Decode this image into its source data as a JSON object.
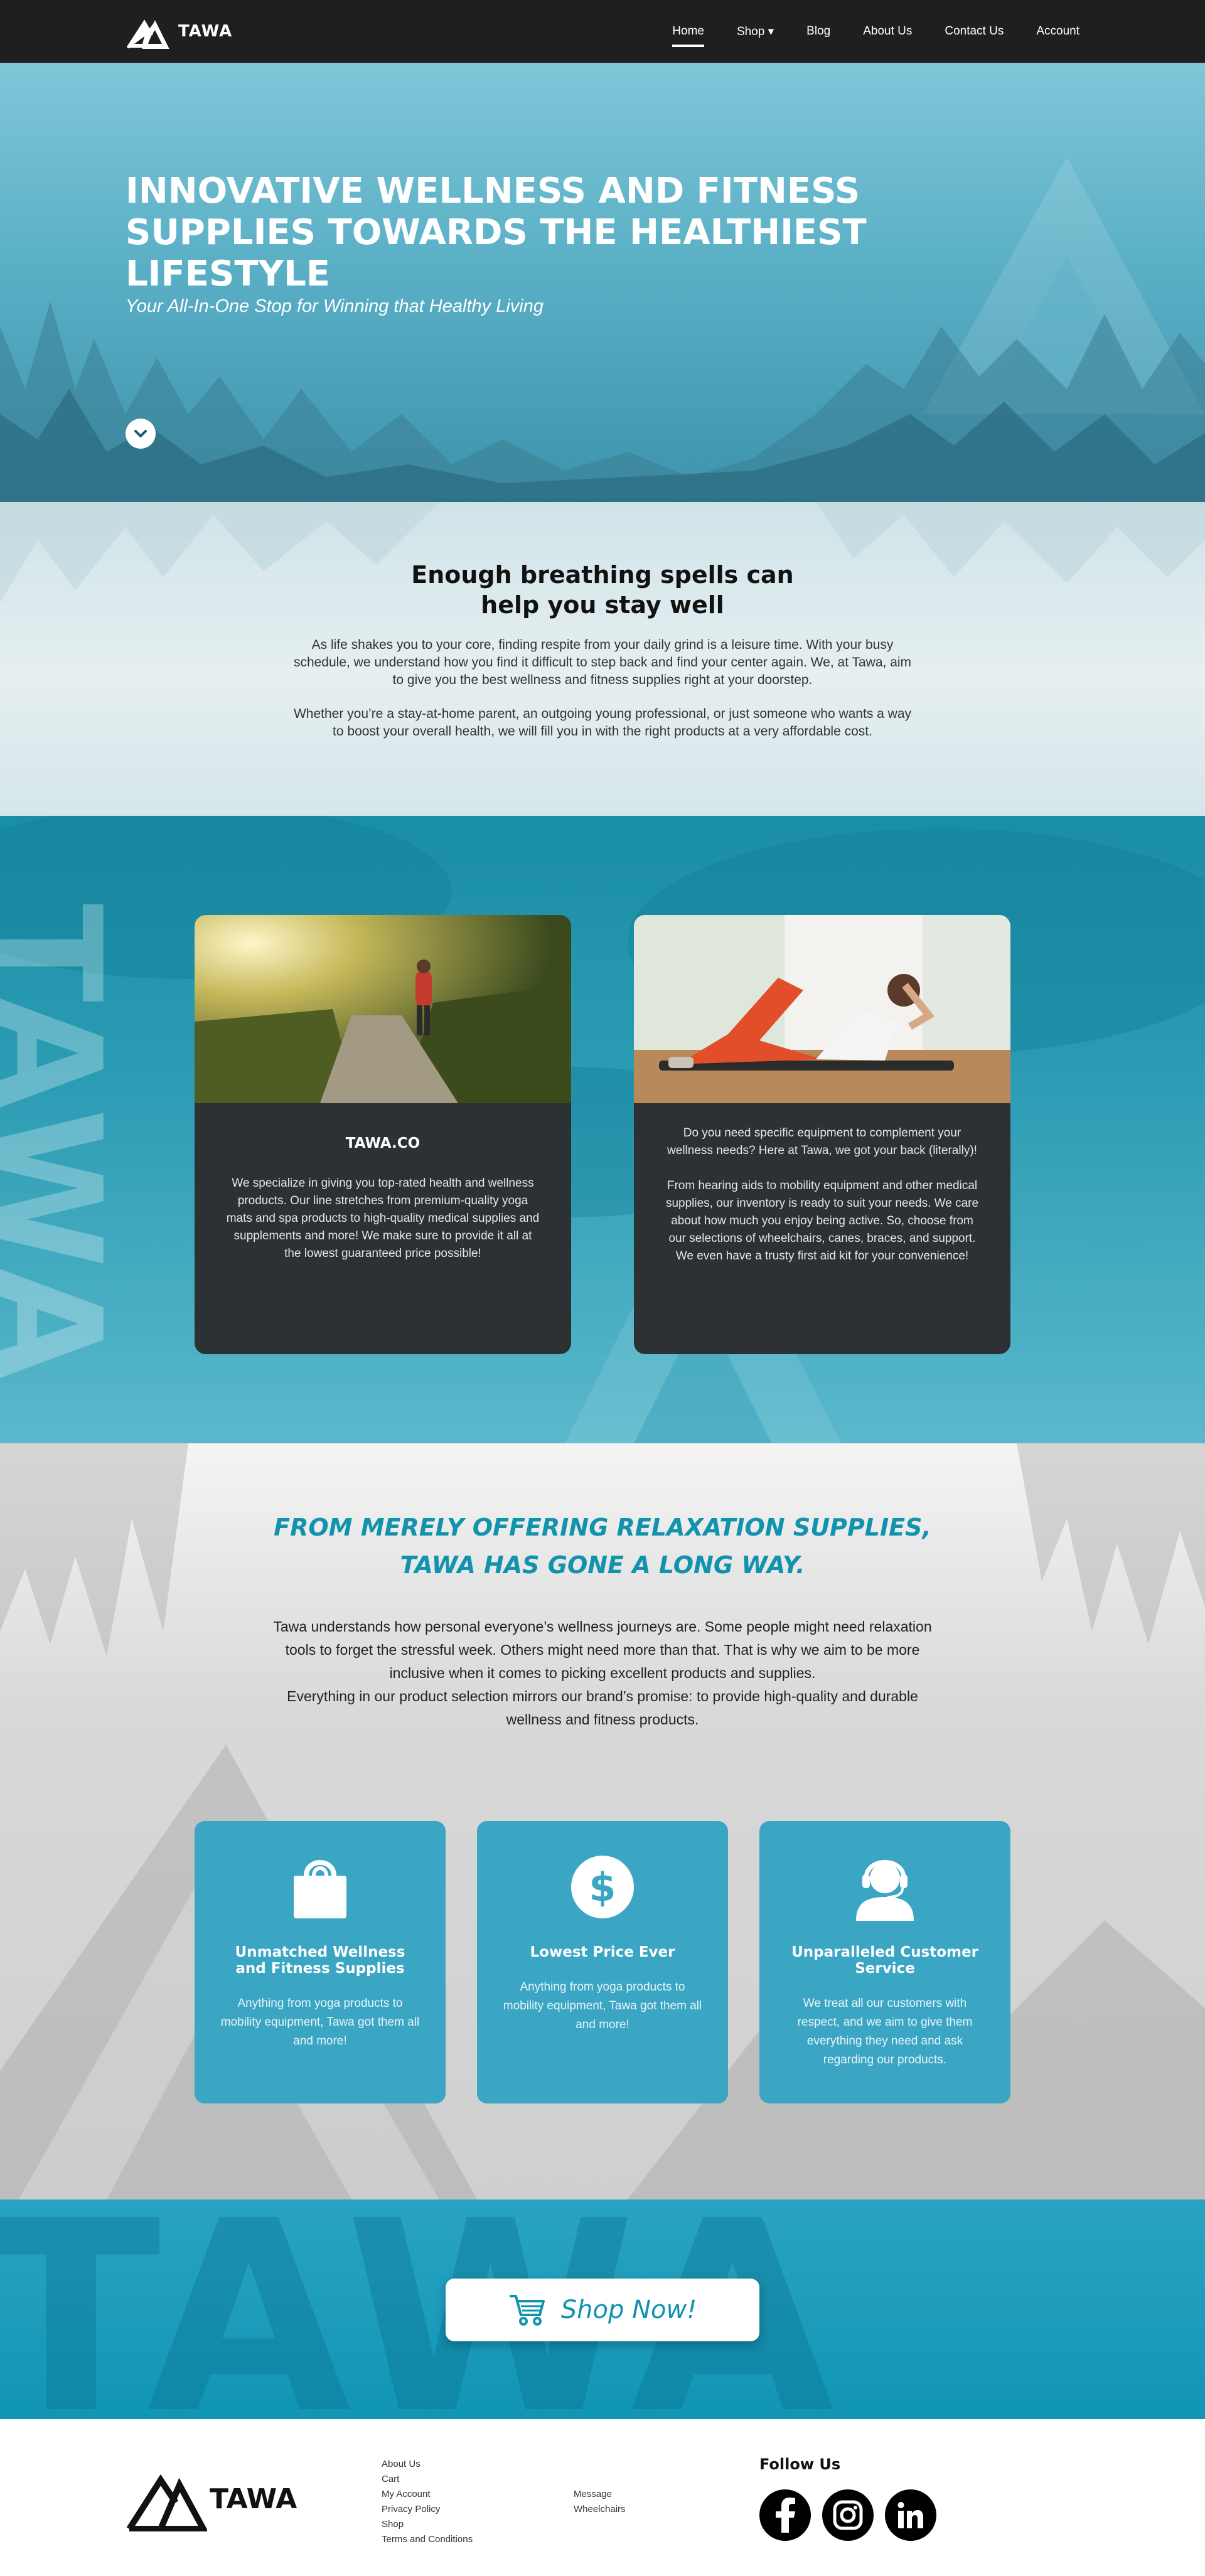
{
  "nav": {
    "logo_text": "TAWA",
    "links": [
      "Home",
      "Shop ▾",
      "Blog",
      "About Us",
      "Contact Us",
      "Account"
    ]
  },
  "hero": {
    "title": "INNOVATIVE WELLNESS AND FITNESS SUPPLIES TOWARDS THE HEALTHIEST LIFESTYLE",
    "subtitle": "Your All-In-One Stop for Winning that Healthy Living"
  },
  "intro": {
    "title": "Enough breathing spells can help you stay well",
    "p1": "As life shakes you to your core, finding respite from your daily grind is a leisure time. With your busy schedule, we understand how you find it difficult to step back and find your center again. We, at Tawa, aim to give you the best wellness and fitness supplies right at your doorstep.",
    "p2": "Whether you’re a stay-at-home parent, an outgoing young professional, or just someone who wants a way to boost your overall health, we will fill you in with the right products at a very affordable cost."
  },
  "cards": {
    "watermark": "TAWA",
    "left": {
      "heading": "TAWA.CO",
      "text": "We specialize in giving you top-rated health and wellness products. Our line stretches from premium-quality yoga mats and spa products to high-quality medical supplies and supplements and more! We make sure to provide it all at the lowest guaranteed price possible!"
    },
    "right": {
      "p1": "Do you need specific equipment to complement your wellness needs? Here at Tawa, we got your back (literally)!",
      "p2": "From hearing aids to mobility equipment and other medical supplies, our inventory is ready to suit your needs. We care about how much you enjoy being active. So, choose from our selections of wheelchairs, canes, braces, and support. We even have a trusty first aid kit for your convenience!"
    }
  },
  "story": {
    "title_line1": "FROM MERELY OFFERING RELAXATION SUPPLIES,",
    "title_line2": "TAWA HAS GONE A LONG WAY.",
    "p1": "Tawa understands how personal everyone’s wellness journeys are. Some people might need relaxation tools to forget the stressful week. Others might need more than that. That is why we aim to be more inclusive when it comes to picking excellent products and supplies.",
    "p2": "Everything in our product selection mirrors our brand’s promise: to provide high-quality and durable wellness and fitness products.",
    "features": [
      {
        "icon": "shopping-bag-icon",
        "title": "Unmatched Wellness and Fitness Supplies",
        "text": "Anything from yoga products to mobility equipment, Tawa got them all and more!"
      },
      {
        "icon": "dollar-icon",
        "title": "Lowest Price Ever",
        "text": "Anything from yoga products to mobility equipment, Tawa got them all and more!"
      },
      {
        "icon": "headset-agent-icon",
        "title": "Unparalleled Customer Service",
        "text": "We treat all our customers with respect, and we aim to give them everything they need and ask regarding our products."
      }
    ]
  },
  "cta": {
    "watermark": "TAWA",
    "button_label": "Shop Now!",
    "icon": "cart-icon"
  },
  "footer": {
    "logo_text": "TAWA",
    "col1": [
      "About Us",
      "Cart",
      "My Account",
      "Privacy Policy",
      "Shop",
      "Terms and Conditions"
    ],
    "col2": [
      "Message",
      "Wheelchairs"
    ],
    "follow_title": "Follow Us",
    "social": [
      "facebook-icon",
      "instagram-icon",
      "linkedin-icon"
    ]
  },
  "colors": {
    "accent": "#1192ad",
    "nav_bg": "#1f1f20",
    "card_bg": "#2c3133",
    "feature_bg": "#3ba6c4"
  }
}
